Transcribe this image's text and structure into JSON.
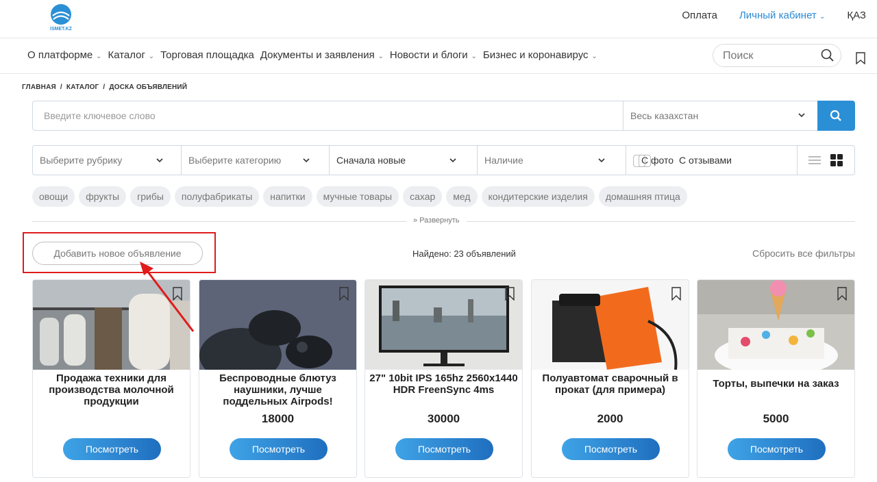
{
  "header": {
    "logo_text": "ISMET.KZ",
    "links": {
      "payment": "Оплата",
      "cabinet": "Личный кабинет",
      "lang": "ҚАЗ"
    }
  },
  "nav": {
    "items": [
      {
        "label": "О платформе",
        "has_chevron": true
      },
      {
        "label": "Каталог",
        "has_chevron": true
      },
      {
        "label": "Торговая площадка",
        "has_chevron": false
      },
      {
        "label": "Документы и заявления",
        "has_chevron": true
      },
      {
        "label": "Новости и блоги",
        "has_chevron": true
      },
      {
        "label": "Бизнес и коронавирус",
        "has_chevron": true
      }
    ],
    "search_placeholder": "Поиск"
  },
  "breadcrumb": [
    "ГЛАВНАЯ",
    "КАТАЛОГ",
    "ДОСКА ОБЪЯВЛЕНИЙ"
  ],
  "search_bar": {
    "keyword_placeholder": "Введите ключевое слово",
    "region": "Весь казахстан"
  },
  "filters": {
    "rubric": "Выберите рубрику",
    "category": "Выберите категорию",
    "sort": "Сначала новые",
    "availability": "Наличие",
    "with_photo": "С фото",
    "with_reviews": "С отзывами"
  },
  "tags": [
    "овощи",
    "фрукты",
    "грибы",
    "полуфабрикаты",
    "напитки",
    "мучные товары",
    "сахар",
    "мед",
    "кондитерские изделия",
    "домашняя птица"
  ],
  "expand_label": "Развернуть",
  "add_button": "Добавить новое объявление",
  "found_text": "Найдено: 23 объявлений",
  "reset_text": "Сбросить все фильтры",
  "cards": [
    {
      "title": "Продажа техники для производства молочной продукции",
      "price": "",
      "button": "Посмотреть"
    },
    {
      "title": "Беспроводные блютуз наушники, лучше поддельных Airpods!",
      "price": "18000",
      "button": "Посмотреть"
    },
    {
      "title": "27\" 10bit IPS 165hz 2560x1440 HDR FreenSync 4ms",
      "price": "30000",
      "button": "Посмотреть"
    },
    {
      "title": "Полуавтомат сварочный в прокат (для примера)",
      "price": "2000",
      "button": "Посмотреть"
    },
    {
      "title": "Торты, выпечки на заказ",
      "price": "5000",
      "button": "Посмотреть"
    }
  ],
  "colors": {
    "accent": "#2b8fd6",
    "highlight": "#e01b1b",
    "link": "#2a8ad4"
  }
}
